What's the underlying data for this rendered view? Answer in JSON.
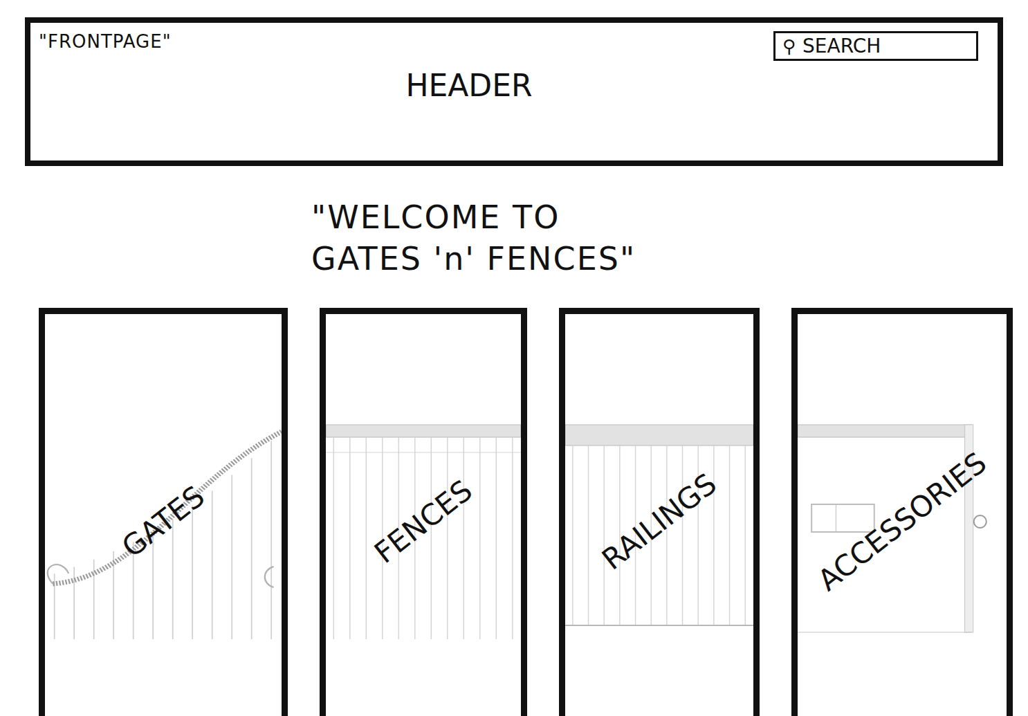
{
  "page": {
    "label": "\"FRONTPAGE\""
  },
  "header": {
    "title": "HEADER"
  },
  "search": {
    "icon": "⚲",
    "placeholder": "SEARCH"
  },
  "welcome": {
    "lines": [
      "\"WELCOME TO",
      "GATES 'n' FENCES\""
    ]
  },
  "categories": [
    {
      "label": "GATES",
      "kind": "gate"
    },
    {
      "label": "FENCES",
      "kind": "fence"
    },
    {
      "label": "RAILINGS",
      "kind": "railing"
    },
    {
      "label": "ACCESSORIES",
      "kind": "accessory"
    }
  ]
}
